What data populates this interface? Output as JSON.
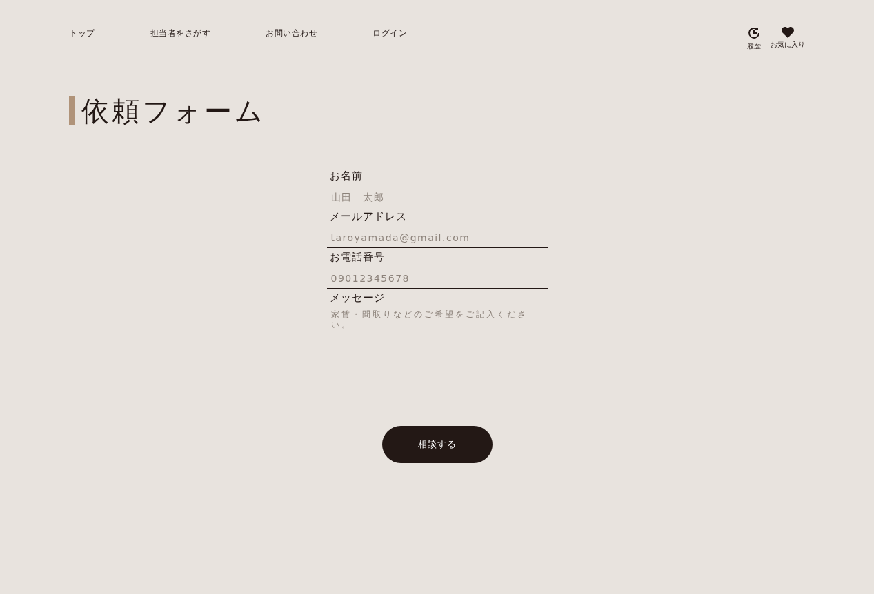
{
  "nav": {
    "links": [
      {
        "label": "トップ"
      },
      {
        "label": "担当者をさがす"
      },
      {
        "label": "お問い合わせ"
      },
      {
        "label": "ログイン"
      }
    ],
    "icons": [
      {
        "kind": "history",
        "label": "履歴"
      },
      {
        "kind": "favorite",
        "label": "お気に入り"
      }
    ]
  },
  "title": "依頼フォーム",
  "form": {
    "fields": [
      {
        "kind": "input",
        "label": "お名前",
        "placeholder": "山田　太郎"
      },
      {
        "kind": "input",
        "label": "メールアドレス",
        "placeholder": "taroyamada@gmail.com"
      },
      {
        "kind": "input",
        "label": "お電話番号",
        "placeholder": "09012345678"
      },
      {
        "kind": "textarea",
        "label": "メッセージ",
        "placeholder": "家賃・間取りなどのご希望をご記入ください。"
      }
    ],
    "submit": "相談する"
  }
}
